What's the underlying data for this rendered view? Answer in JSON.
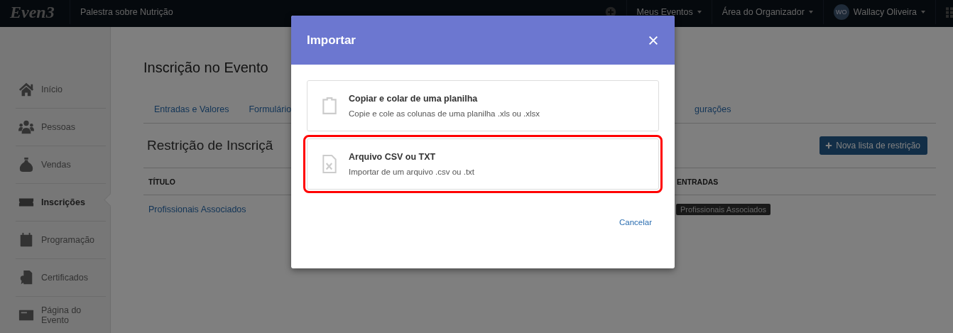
{
  "topbar": {
    "logo": "Even3",
    "event_name": "Palestra sobre Nutrição",
    "menus": [
      {
        "kind": "add"
      },
      {
        "kind": "menu",
        "label": "Meus Eventos"
      },
      {
        "kind": "menu",
        "label": "Área do Organizador"
      },
      {
        "kind": "user",
        "initials": "WO",
        "label": "Wallacy Oliveira"
      },
      {
        "kind": "apps"
      }
    ]
  },
  "sidebar": {
    "items": [
      {
        "label": "Início",
        "selected": false
      },
      {
        "label": "Pessoas",
        "selected": false
      },
      {
        "label": "Vendas",
        "selected": false
      },
      {
        "label": "Inscrições",
        "selected": true
      },
      {
        "label": "Programação",
        "selected": false
      },
      {
        "label": "Certificados",
        "selected": false
      },
      {
        "label": "Página do Evento",
        "selected": false
      }
    ]
  },
  "page": {
    "title": "Inscrição no Evento",
    "tabs": [
      {
        "label": "Entradas e Valores",
        "selected": false
      },
      {
        "label": "Formulário",
        "selected": false
      },
      {
        "label": "gurações",
        "selected": false
      }
    ],
    "section_title": "Restrição de Inscriçã",
    "new_button": "Nova lista de restrição",
    "table": {
      "columns": [
        "TÍTULO",
        "ENTRADAS"
      ],
      "rows": [
        {
          "title": "Profissionais Associados",
          "entries": [
            "Profissionais Associados"
          ]
        }
      ]
    }
  },
  "modal": {
    "title": "Importar",
    "options": [
      {
        "title": "Copiar e colar de uma planilha",
        "description": "Copie e cole as colunas de uma planilha .xls ou .xlsx",
        "highlighted": false
      },
      {
        "title": "Arquivo CSV ou TXT",
        "description": "Importar de um arquivo .csv ou .txt",
        "highlighted": true
      }
    ],
    "cancel": "Cancelar"
  }
}
